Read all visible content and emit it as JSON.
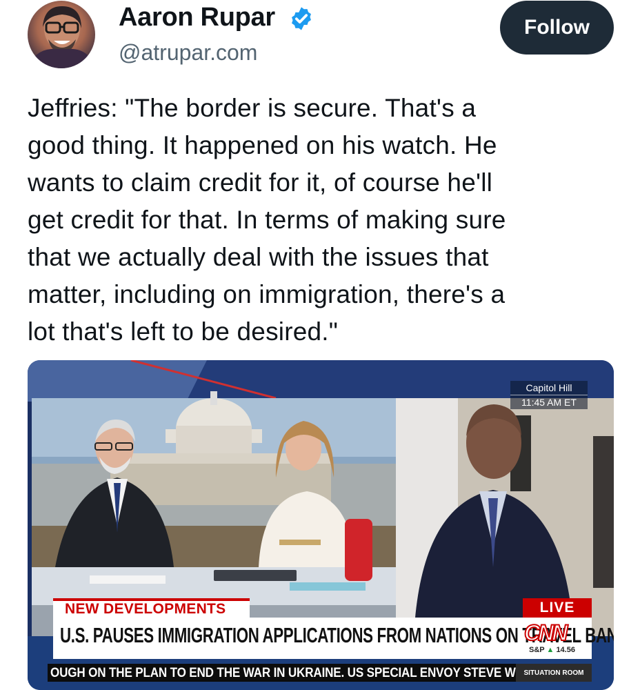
{
  "author": {
    "name": "Aaron Rupar",
    "handle": "@atrupar.com",
    "verified": true,
    "avatar_icon": "profile-photo"
  },
  "follow_label": "Follow",
  "tweet": {
    "text": "Jeffries: \"The border is secure. That's a\ngood thing. It happened on his watch. He\nwants to claim credit for it, of course he'll\nget credit for that. In terms of making sure\nthat we actually deal with the issues that\nmatter, including on immigration, there's a\nlot that's left to be desired.\""
  },
  "media": {
    "location": "Capitol Hill",
    "time": "11:45 AM ET",
    "tag_left": "NEW DEVELOPMENTS",
    "tag_right": "LIVE",
    "headline": "U.S. PAUSES IMMIGRATION APPLICATIONS FROM NATIONS ON TRAVEL BAN LIST",
    "network_logo": "CNN",
    "ticker_market": "S&P",
    "ticker_value": "14.56",
    "ticker_text": "OUGH ON THE PLAN TO END THE WAR IN UKRAINE. US SPECIAL ENVOY STEVE WITKOFF",
    "show_name": "SITUATION ROOM"
  },
  "colors": {
    "verified_blue": "#1d9bf0",
    "follow_bg": "#1e2b37",
    "cnn_red": "#cc0000"
  }
}
